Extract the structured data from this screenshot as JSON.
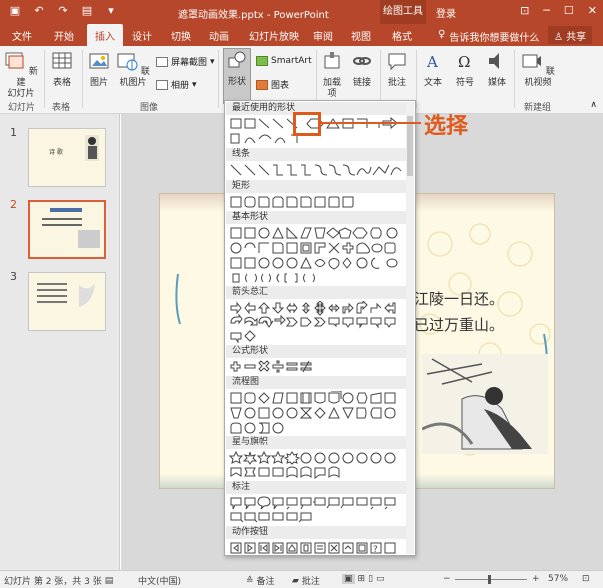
{
  "titlebar": {
    "doc_title": "遮罩动画效果.pptx - PowerPoint",
    "context_tab": "绘图工具",
    "login": "登录"
  },
  "tabs": [
    "文件",
    "开始",
    "插入",
    "设计",
    "切换",
    "动画",
    "幻灯片放映",
    "审阅",
    "视图",
    "格式"
  ],
  "active_tab": "插入",
  "tell_me": "告诉我你想要做什么",
  "share": "共享",
  "ribbon": {
    "new_slide": "新建\n幻灯片",
    "table": "表格",
    "picture": "图片",
    "online_picture": "联机图片",
    "screenshot": "屏幕截图",
    "album": "相册",
    "shapes": "形状",
    "smartart": "SmartArt",
    "chart": "图表",
    "addins": "加载\n项",
    "link": "链接",
    "comment": "批注",
    "text": "文本",
    "symbol": "符号",
    "media": "媒体",
    "online_video": "联机视频",
    "groups": {
      "slides": "幻灯片",
      "tables": "表格",
      "images": "图像",
      "newgroup": "新建组"
    }
  },
  "slides_pane": {
    "numbers": [
      "1",
      "2",
      "3"
    ],
    "thumb1_title": "诗 歌"
  },
  "slide": {
    "line1": "江陵一日还。",
    "line2": "已过万重山。"
  },
  "shapes_menu": {
    "sections": [
      "最近使用的形状",
      "线条",
      "矩形",
      "基本形状",
      "箭头总汇",
      "公式形状",
      "流程图",
      "星与旗帜",
      "标注",
      "动作按钮"
    ]
  },
  "callout": "选择",
  "status": {
    "slide_info": "幻灯片 第 2 张，共 3 张",
    "language": "中文(中国)",
    "notes": "备注",
    "comments": "批注",
    "zoom": "57%"
  },
  "colors": {
    "accent": "#b7472a",
    "highlight": "#e05a1c"
  }
}
